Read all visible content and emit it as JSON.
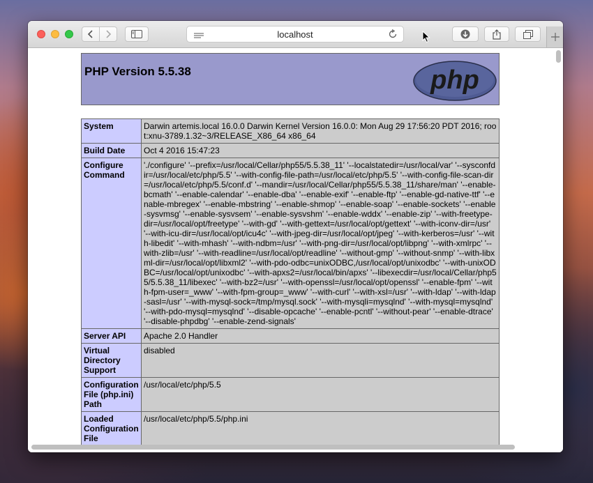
{
  "browser": {
    "url": "localhost",
    "icons": [
      "back-icon",
      "forward-icon",
      "sidebar-icon",
      "reader-icon",
      "reload-icon",
      "download-icon",
      "share-icon",
      "tabs-icon",
      "plus-icon"
    ]
  },
  "page": {
    "title": "PHP Version 5.5.38",
    "logo_text": "php"
  },
  "info_rows": [
    {
      "label": "System",
      "value": "Darwin artemis.local 16.0.0 Darwin Kernel Version 16.0.0: Mon Aug 29 17:56:20 PDT 2016; root:xnu-3789.1.32~3/RELEASE_X86_64 x86_64"
    },
    {
      "label": "Build Date",
      "value": "Oct 4 2016 15:47:23"
    },
    {
      "label": "Configure Command",
      "value": "'./configure' '--prefix=/usr/local/Cellar/php55/5.5.38_11' '--localstatedir=/usr/local/var' '--sysconfdir=/usr/local/etc/php/5.5' '--with-config-file-path=/usr/local/etc/php/5.5' '--with-config-file-scan-dir=/usr/local/etc/php/5.5/conf.d' '--mandir=/usr/local/Cellar/php55/5.5.38_11/share/man' '--enable-bcmath' '--enable-calendar' '--enable-dba' '--enable-exif' '--enable-ftp' '--enable-gd-native-ttf' '--enable-mbregex' '--enable-mbstring' '--enable-shmop' '--enable-soap' '--enable-sockets' '--enable-sysvmsg' '--enable-sysvsem' '--enable-sysvshm' '--enable-wddx' '--enable-zip' '--with-freetype-dir=/usr/local/opt/freetype' '--with-gd' '--with-gettext=/usr/local/opt/gettext' '--with-iconv-dir=/usr' '--with-icu-dir=/usr/local/opt/icu4c' '--with-jpeg-dir=/usr/local/opt/jpeg' '--with-kerberos=/usr' '--with-libedit' '--with-mhash' '--with-ndbm=/usr' '--with-png-dir=/usr/local/opt/libpng' '--with-xmlrpc' '--with-zlib=/usr' '--with-readline=/usr/local/opt/readline' '--without-gmp' '--without-snmp' '--with-libxml-dir=/usr/local/opt/libxml2' '--with-pdo-odbc=unixODBC,/usr/local/opt/unixodbc' '--with-unixODBC=/usr/local/opt/unixodbc' '--with-apxs2=/usr/local/bin/apxs' '--libexecdir=/usr/local/Cellar/php55/5.5.38_11/libexec' '--with-bz2=/usr' '--with-openssl=/usr/local/opt/openssl' '--enable-fpm' '--with-fpm-user=_www' '--with-fpm-group=_www' '--with-curl' '--with-xsl=/usr' '--with-ldap' '--with-ldap-sasl=/usr' '--with-mysql-sock=/tmp/mysql.sock' '--with-mysqli=mysqlnd' '--with-mysql=mysqlnd' '--with-pdo-mysql=mysqlnd' '--disable-opcache' '--enable-pcntl' '--without-pear' '--enable-dtrace' '--disable-phpdbg' '--enable-zend-signals'"
    },
    {
      "label": "Server API",
      "value": "Apache 2.0 Handler"
    },
    {
      "label": "Virtual Directory Support",
      "value": "disabled"
    },
    {
      "label": "Configuration File (php.ini) Path",
      "value": "/usr/local/etc/php/5.5"
    },
    {
      "label": "Loaded Configuration File",
      "value": "/usr/local/etc/php/5.5/php.ini"
    }
  ]
}
